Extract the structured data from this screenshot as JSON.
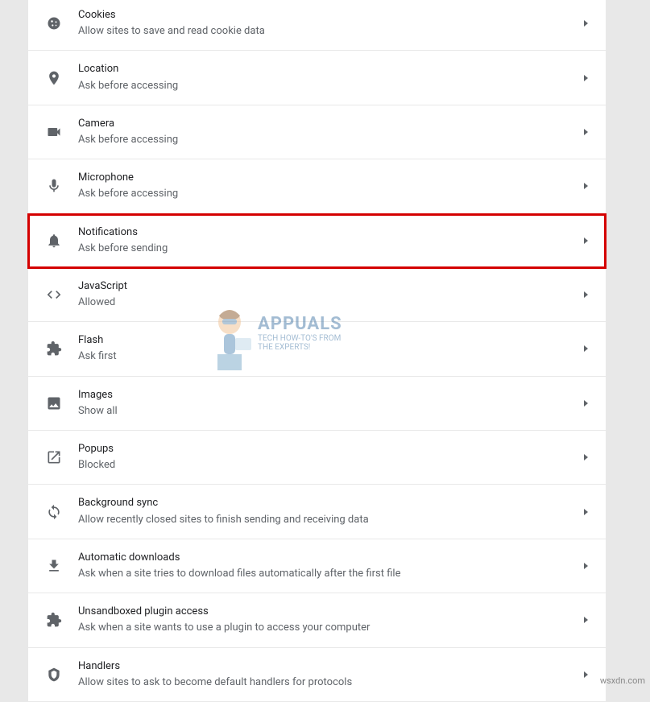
{
  "settings": [
    {
      "id": "cookies",
      "icon": "cookie-icon",
      "title": "Cookies",
      "subtitle": "Allow sites to save and read cookie data",
      "highlighted": false
    },
    {
      "id": "location",
      "icon": "location-icon",
      "title": "Location",
      "subtitle": "Ask before accessing",
      "highlighted": false
    },
    {
      "id": "camera",
      "icon": "camera-icon",
      "title": "Camera",
      "subtitle": "Ask before accessing",
      "highlighted": false
    },
    {
      "id": "microphone",
      "icon": "microphone-icon",
      "title": "Microphone",
      "subtitle": "Ask before accessing",
      "highlighted": false
    },
    {
      "id": "notifications",
      "icon": "bell-icon",
      "title": "Notifications",
      "subtitle": "Ask before sending",
      "highlighted": true
    },
    {
      "id": "javascript",
      "icon": "code-icon",
      "title": "JavaScript",
      "subtitle": "Allowed",
      "highlighted": false
    },
    {
      "id": "flash",
      "icon": "extension-icon",
      "title": "Flash",
      "subtitle": "Ask first",
      "highlighted": false
    },
    {
      "id": "images",
      "icon": "image-icon",
      "title": "Images",
      "subtitle": "Show all",
      "highlighted": false
    },
    {
      "id": "popups",
      "icon": "popup-icon",
      "title": "Popups",
      "subtitle": "Blocked",
      "highlighted": false
    },
    {
      "id": "background-sync",
      "icon": "sync-icon",
      "title": "Background sync",
      "subtitle": "Allow recently closed sites to finish sending and receiving data",
      "highlighted": false
    },
    {
      "id": "automatic-downloads",
      "icon": "download-icon",
      "title": "Automatic downloads",
      "subtitle": "Ask when a site tries to download files automatically after the first file",
      "highlighted": false
    },
    {
      "id": "unsandboxed-plugin-access",
      "icon": "extension-icon",
      "title": "Unsandboxed plugin access",
      "subtitle": "Ask when a site wants to use a plugin to access your computer",
      "highlighted": false
    },
    {
      "id": "handlers",
      "icon": "handlers-icon",
      "title": "Handlers",
      "subtitle": "Allow sites to ask to become default handlers for protocols",
      "highlighted": false
    }
  ],
  "watermark": {
    "title": "APPUALS",
    "subtitle1": "TECH HOW-TO'S FROM",
    "subtitle2": "THE EXPERTS!"
  },
  "attribution": "wsxdn.com"
}
